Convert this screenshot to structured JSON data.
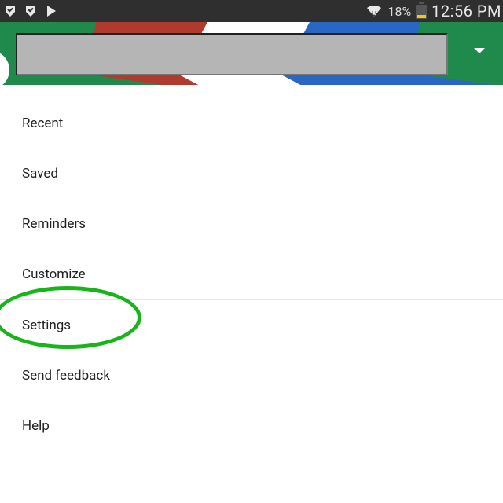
{
  "status_bar": {
    "icons": {
      "checkmark1": "check-icon",
      "checkmark2": "check-icon",
      "play_store": "play-store-icon",
      "wifi": "wifi-icon"
    },
    "battery_percent": "18%",
    "time": "12:56 PM"
  },
  "header": {
    "search_value": "",
    "search_placeholder": "",
    "brand_colors": {
      "green": "#1f8a4c",
      "red": "#b13a2f",
      "blue": "#2a67c4",
      "white": "#ffffff"
    }
  },
  "menu": {
    "group1": {
      "items": [
        {
          "label": "Recent"
        },
        {
          "label": "Saved"
        },
        {
          "label": "Reminders"
        },
        {
          "label": "Customize"
        }
      ]
    },
    "group2": {
      "items": [
        {
          "label": "Settings"
        },
        {
          "label": "Send feedback"
        },
        {
          "label": "Help"
        }
      ]
    }
  },
  "annotation": {
    "type": "ellipse",
    "target": "Settings",
    "color": "#18b51a"
  }
}
